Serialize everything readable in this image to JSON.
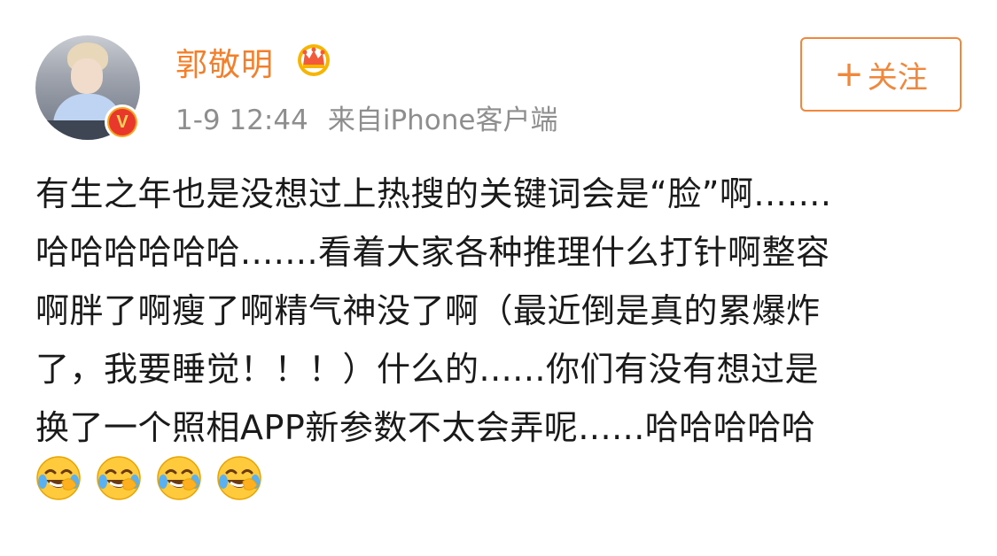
{
  "user": {
    "name": "郭敬明",
    "avatar_icon": "user-avatar",
    "verified_badge": "V",
    "vip_icon": "crown-icon"
  },
  "meta": {
    "time": "1-9 12:44",
    "source": "来自iPhone客户端"
  },
  "follow_button": {
    "plus": "+",
    "label": "关注"
  },
  "post": {
    "lines": [
      "有生之年也是没想过上热搜的关键词会是“脸”啊.......",
      "哈哈哈哈哈哈.......看着大家各种推理什么打针啊整容",
      "啊胖了啊瘦了啊精气神没了啊（最近倒是真的累爆炸",
      "了，我要睡觉！！！）什么的......你们有没有想过是",
      "换了一个照相APP新参数不太会弄呢......哈哈哈哈哈"
    ],
    "emojis": [
      "laugh-cry-emoji",
      "laugh-cry-emoji",
      "laugh-cry-emoji",
      "laugh-cry-emoji"
    ]
  },
  "colors": {
    "accent": "#f47f2b",
    "meta_text": "#8e8e8e",
    "body_text": "#1a1a1a"
  }
}
